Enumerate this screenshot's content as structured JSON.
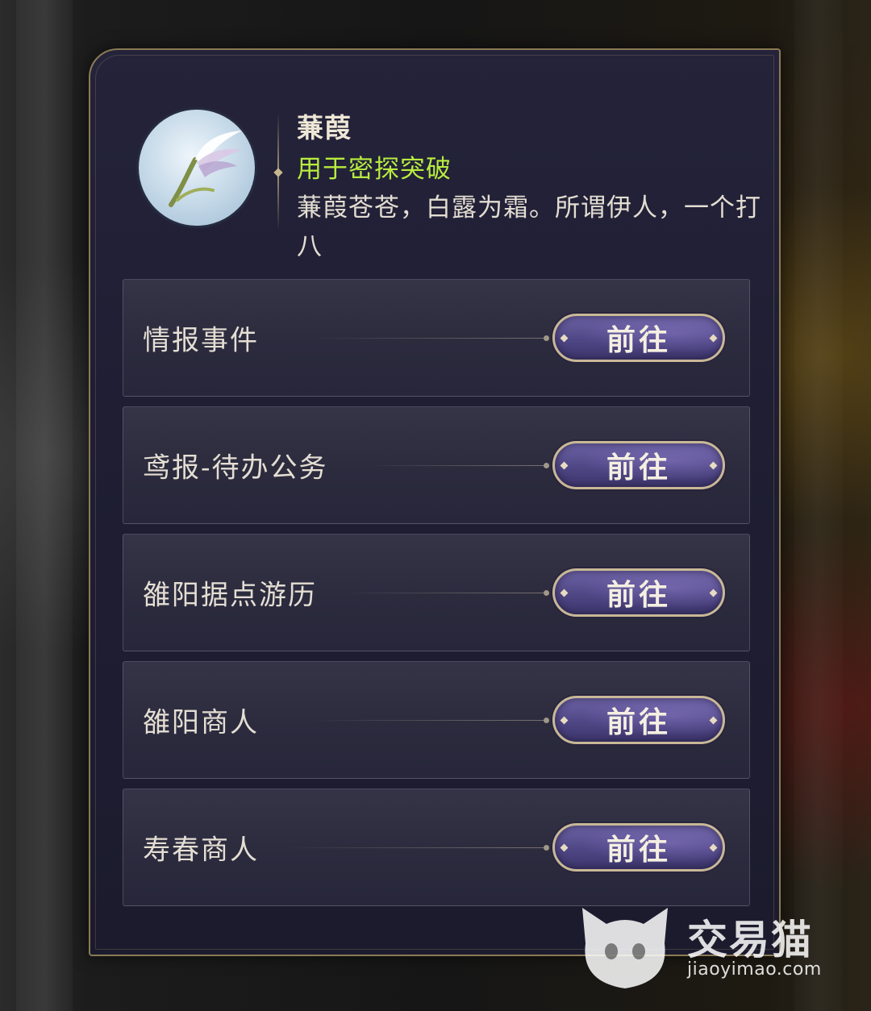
{
  "item": {
    "name": "蒹葭",
    "usage": "用于密探突破",
    "description": "蒹葭苍苍，白露为霜。所谓伊人，一个打八",
    "icon": "reed-feather-icon"
  },
  "sources": [
    {
      "label": "情报事件",
      "button": "前往"
    },
    {
      "label": "鸢报-待办公务",
      "button": "前往"
    },
    {
      "label": "雒阳据点游历",
      "button": "前往"
    },
    {
      "label": "雒阳商人",
      "button": "前往"
    },
    {
      "label": "寿春商人",
      "button": "前往"
    }
  ],
  "watermark": {
    "name": "交易猫",
    "url": "jiaoyimao.com"
  },
  "colors": {
    "usage_text": "#b8ec3e",
    "panel_border": "#8b7a55",
    "button_fill": "#4f4685"
  }
}
